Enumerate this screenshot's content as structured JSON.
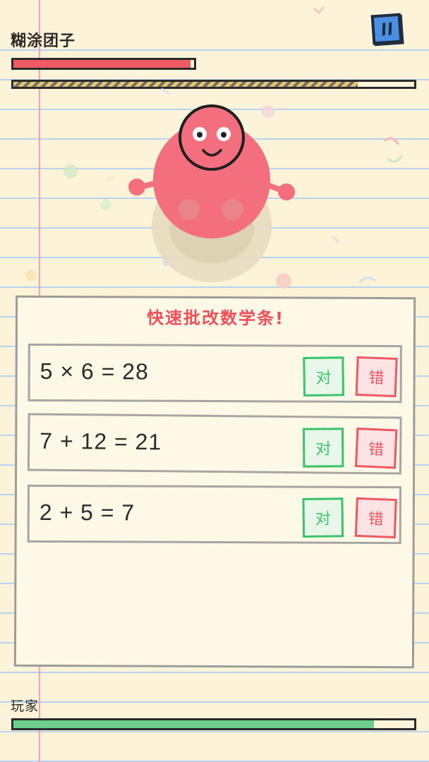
{
  "enemy": {
    "name": "糊涂团子",
    "hp_fraction": 0.98
  },
  "timer": {
    "remaining_fraction": 0.86
  },
  "pause": {
    "icon": "pause-icon",
    "color": "#4a90e2"
  },
  "quiz": {
    "prompt": "快速批改数学条!",
    "right_label": "对",
    "wrong_label": "错",
    "items": [
      {
        "equation": "5 × 6 = 28"
      },
      {
        "equation": "7 + 12 = 21"
      },
      {
        "equation": "2 + 5 = 7"
      }
    ]
  },
  "player": {
    "name": "玩家",
    "hp_fraction": 0.9
  },
  "colors": {
    "monster": "#f36f7d",
    "accent_red": "#ef4f59",
    "accent_green": "#39c46a"
  }
}
